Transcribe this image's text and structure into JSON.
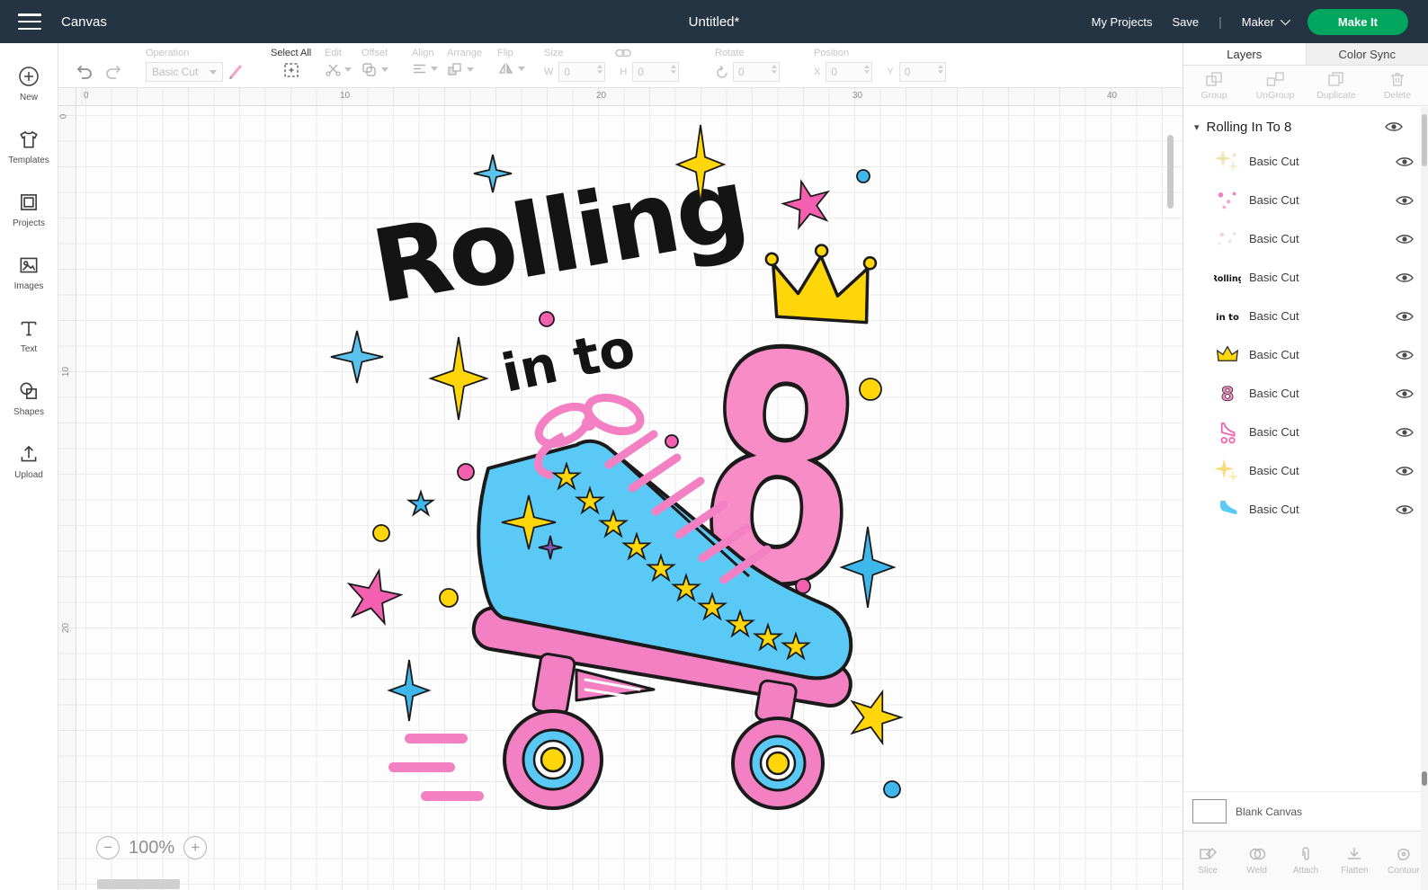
{
  "topbar": {
    "canvas_label": "Canvas",
    "title": "Untitled*",
    "my_projects": "My Projects",
    "save": "Save",
    "divider": "|",
    "machine": "Maker",
    "make_it": "Make It"
  },
  "sidebar": {
    "items": [
      {
        "label": "New"
      },
      {
        "label": "Templates"
      },
      {
        "label": "Projects"
      },
      {
        "label": "Images"
      },
      {
        "label": "Text"
      },
      {
        "label": "Shapes"
      },
      {
        "label": "Upload"
      }
    ]
  },
  "toolbar": {
    "operation": {
      "label": "Operation",
      "value": "Basic Cut"
    },
    "select_all_label": "Select All",
    "edit_label": "Edit",
    "offset_label": "Offset",
    "align_label": "Align",
    "arrange_label": "Arrange",
    "flip_label": "Flip",
    "size": {
      "label": "Size",
      "w_label": "W",
      "h_label": "H",
      "w_value": "0",
      "h_value": "0"
    },
    "rotate": {
      "label": "Rotate",
      "value": "0"
    },
    "position": {
      "label": "Position",
      "x_label": "X",
      "y_label": "Y",
      "x_value": "0",
      "y_value": "0"
    }
  },
  "canvas": {
    "h_ruler": [
      "0",
      "10",
      "20",
      "30",
      "40"
    ],
    "v_ruler": [
      "0",
      "10",
      "20"
    ],
    "zoom_level": "100%",
    "artwork": {
      "word1": "Rolling",
      "word2": "in to",
      "number": "8"
    }
  },
  "layers_panel": {
    "tabs": [
      {
        "label": "Layers"
      },
      {
        "label": "Color Sync"
      }
    ],
    "actions": [
      {
        "label": "Group"
      },
      {
        "label": "UnGroup"
      },
      {
        "label": "Duplicate"
      },
      {
        "label": "Delete"
      }
    ],
    "group": {
      "title": "Rolling In To 8"
    },
    "layers": [
      {
        "label": "Basic Cut",
        "thumb": "sparkles-faint"
      },
      {
        "label": "Basic Cut",
        "thumb": "dots-pink"
      },
      {
        "label": "Basic Cut",
        "thumb": "dots-faint"
      },
      {
        "label": "Basic Cut",
        "thumb": "word-rolling"
      },
      {
        "label": "Basic Cut",
        "thumb": "word-in-to"
      },
      {
        "label": "Basic Cut",
        "thumb": "crown"
      },
      {
        "label": "Basic Cut",
        "thumb": "number-eight"
      },
      {
        "label": "Basic Cut",
        "thumb": "skate-pink"
      },
      {
        "label": "Basic Cut",
        "thumb": "sparkles-yellow"
      },
      {
        "label": "Basic Cut",
        "thumb": "skate-blue"
      }
    ],
    "blank_canvas_label": "Blank Canvas",
    "bottom_actions": [
      {
        "label": "Slice"
      },
      {
        "label": "Weld"
      },
      {
        "label": "Attach"
      },
      {
        "label": "Flatten"
      },
      {
        "label": "Contour"
      }
    ]
  },
  "icons": {
    "caret_down": "▾",
    "chevron_down": "⌄",
    "minus": "−",
    "plus": "+"
  },
  "colors": {
    "topbar_bg": "#253442",
    "accent_green": "#00a65e",
    "pink": "#f480c4",
    "blue": "#5bc9f5",
    "yellow": "#ffd60a"
  }
}
